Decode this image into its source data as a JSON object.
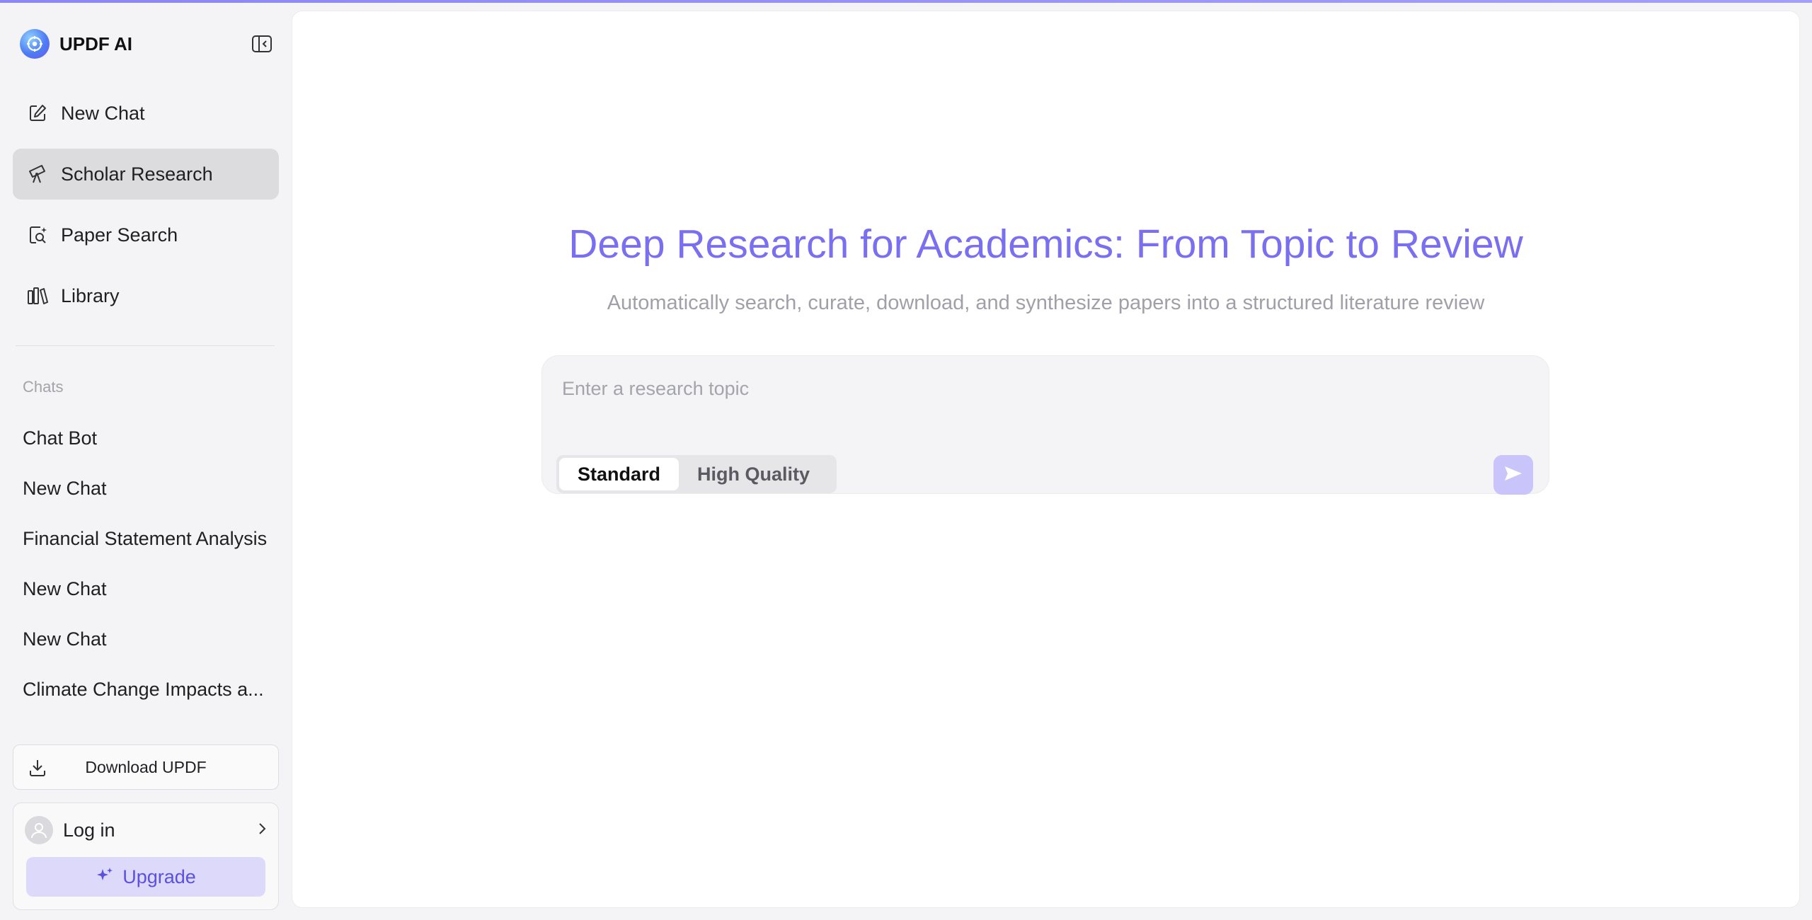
{
  "app": {
    "name": "UPDF AI"
  },
  "nav": [
    {
      "label": "New Chat",
      "icon": "edit-icon",
      "active": false
    },
    {
      "label": "Scholar Research",
      "icon": "telescope-icon",
      "active": true
    },
    {
      "label": "Paper Search",
      "icon": "doc-search-icon",
      "active": false
    },
    {
      "label": "Library",
      "icon": "books-icon",
      "active": false
    }
  ],
  "chats": {
    "title": "Chats",
    "items": [
      "Chat Bot",
      "New Chat",
      "Financial Statement Analysis",
      "New Chat",
      "New Chat",
      "Climate Change Impacts a..."
    ]
  },
  "footer": {
    "download_label": "Download UPDF",
    "login_label": "Log in",
    "upgrade_label": "Upgrade"
  },
  "hero": {
    "title": "Deep Research for Academics: From Topic to Review",
    "subtitle": "Automatically search, curate, download, and synthesize papers into a structured literature review"
  },
  "composer": {
    "placeholder": "Enter a research topic",
    "value": "",
    "modes": [
      "Standard",
      "High Quality"
    ],
    "selected_mode": "Standard"
  },
  "colors": {
    "accent": "#7a6ff0",
    "active_nav_bg": "#dcdcde",
    "upgrade_bg": "#dcd9fb",
    "send_bg": "#c9c5fb"
  }
}
